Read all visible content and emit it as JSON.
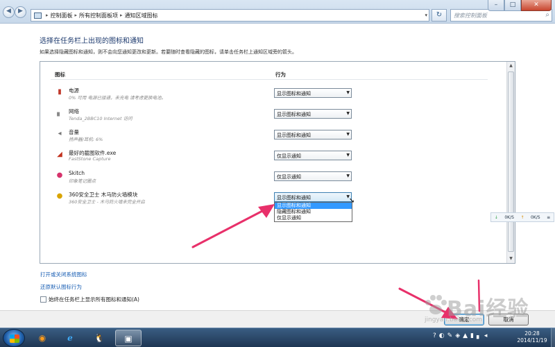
{
  "address": {
    "crumbs": [
      "控制面板",
      "所有控制面板项",
      "通知区域图标"
    ],
    "search_placeholder": "搜索控制面板"
  },
  "window_controls": {
    "minimize": "–",
    "maximize": "□",
    "close": "✕"
  },
  "page": {
    "title": "选择在任务栏上出现的图标和通知",
    "description": "如果选择隐藏图标和通知，则不会向您通知更改和更新。若要随时查看隐藏的图标，请单击任务栏上通知区域旁的箭头。"
  },
  "table": {
    "col_icon": "图标",
    "col_behavior": "行为",
    "rows": [
      {
        "icon": "battery-icon",
        "name": "电源",
        "desc": "0% 可用 电源已接通，未充电  请考虑更换电池。",
        "behavior": "显示图标和通知"
      },
      {
        "icon": "network-icon",
        "name": "网络",
        "desc": "Tenda_2BBC10 Internet 访问",
        "behavior": "显示图标和通知"
      },
      {
        "icon": "volume-icon",
        "name": "音量",
        "desc": "扬声器/耳机: 6%",
        "behavior": "显示图标和通知"
      },
      {
        "icon": "faststone-icon",
        "name": "最好的截图软件.exe",
        "desc": "FastStone Capture",
        "behavior": "仅显示通知"
      },
      {
        "icon": "skitch-icon",
        "name": "Skitch",
        "desc": "印象笔记圈点",
        "behavior": "仅显示通知"
      },
      {
        "icon": "360-icon",
        "name": "360安全卫士 木马防火墙模块",
        "desc": "360安全卫士 - 木马防火墙未完全开启",
        "behavior": "显示图标和通知"
      }
    ],
    "dropdown_options": [
      "显示图标和通知",
      "隐藏图标和通知",
      "仅显示通知"
    ],
    "dropdown_selected": "显示图标和通知"
  },
  "links": {
    "system_icons": "打开或关闭系统图标",
    "restore_default": "还原默认图标行为"
  },
  "always_show_checkbox": "始终在任务栏上显示所有图标和通知(A)",
  "netspeed": {
    "down": "0K/S",
    "up": "0K/S"
  },
  "buttons": {
    "ok": "确定",
    "cancel": "取消"
  },
  "watermark": {
    "text": "Bai经验",
    "url": "jingyan.baidu.com"
  },
  "clock": {
    "time": "20:28",
    "date": "2014/11/19"
  },
  "colors": {
    "arrow": "#e8306a",
    "link": "#1a5fb4",
    "selection": "#3399ff"
  }
}
